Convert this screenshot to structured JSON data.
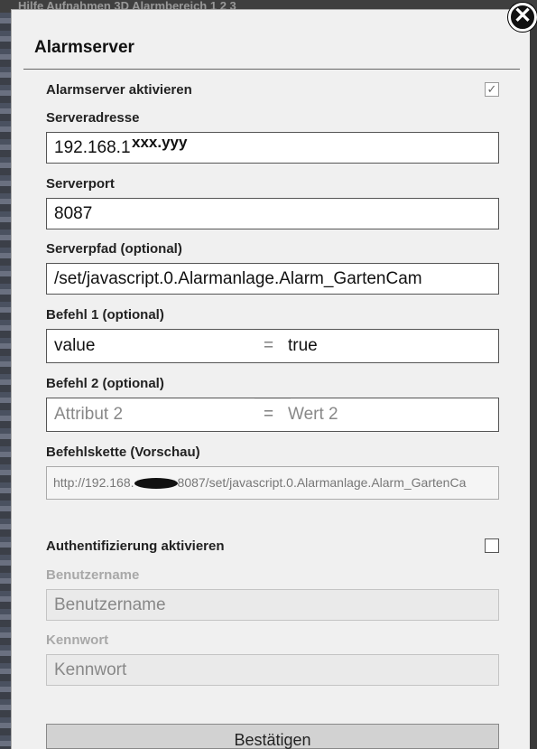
{
  "background": {
    "strip_text": "Hilfe   Aufnahmen   3D   Alarmbereich   1   2   3"
  },
  "dialog": {
    "title": "Alarmserver",
    "close_icon": "close-icon"
  },
  "alarmserver": {
    "enable_label": "Alarmserver aktivieren",
    "enabled": true,
    "address_label": "Serveradresse",
    "address_value_visible": "192.168.1.",
    "address_overlay": "xxx.yyy",
    "port_label": "Serverport",
    "port_value": "8087",
    "path_label": "Serverpfad (optional)",
    "path_value": "/set/javascript.0.Alarmanlage.Alarm_GartenCam",
    "cmd1_label": "Befehl 1 (optional)",
    "cmd1_attr": "value",
    "cmd1_eq": "=",
    "cmd1_val": "true",
    "cmd2_label": "Befehl 2 (optional)",
    "cmd2_attr_placeholder": "Attribut 2",
    "cmd2_eq": "=",
    "cmd2_val_placeholder": "Wert 2",
    "chain_label": "Befehlskette (Vorschau)",
    "chain_prefix": "http://192.168.",
    "chain_suffix": "8087/set/javascript.0.Alarmanlage.Alarm_GartenCa"
  },
  "auth": {
    "enable_label": "Authentifizierung aktivieren",
    "enabled": false,
    "user_label": "Benutzername",
    "user_placeholder": "Benutzername",
    "pass_label": "Kennwort",
    "pass_placeholder": "Kennwort"
  },
  "submit_label": "Bestätigen",
  "colors": {
    "dialog_bg": "#f0f0f0",
    "disabled_text": "#a8a8a8"
  }
}
